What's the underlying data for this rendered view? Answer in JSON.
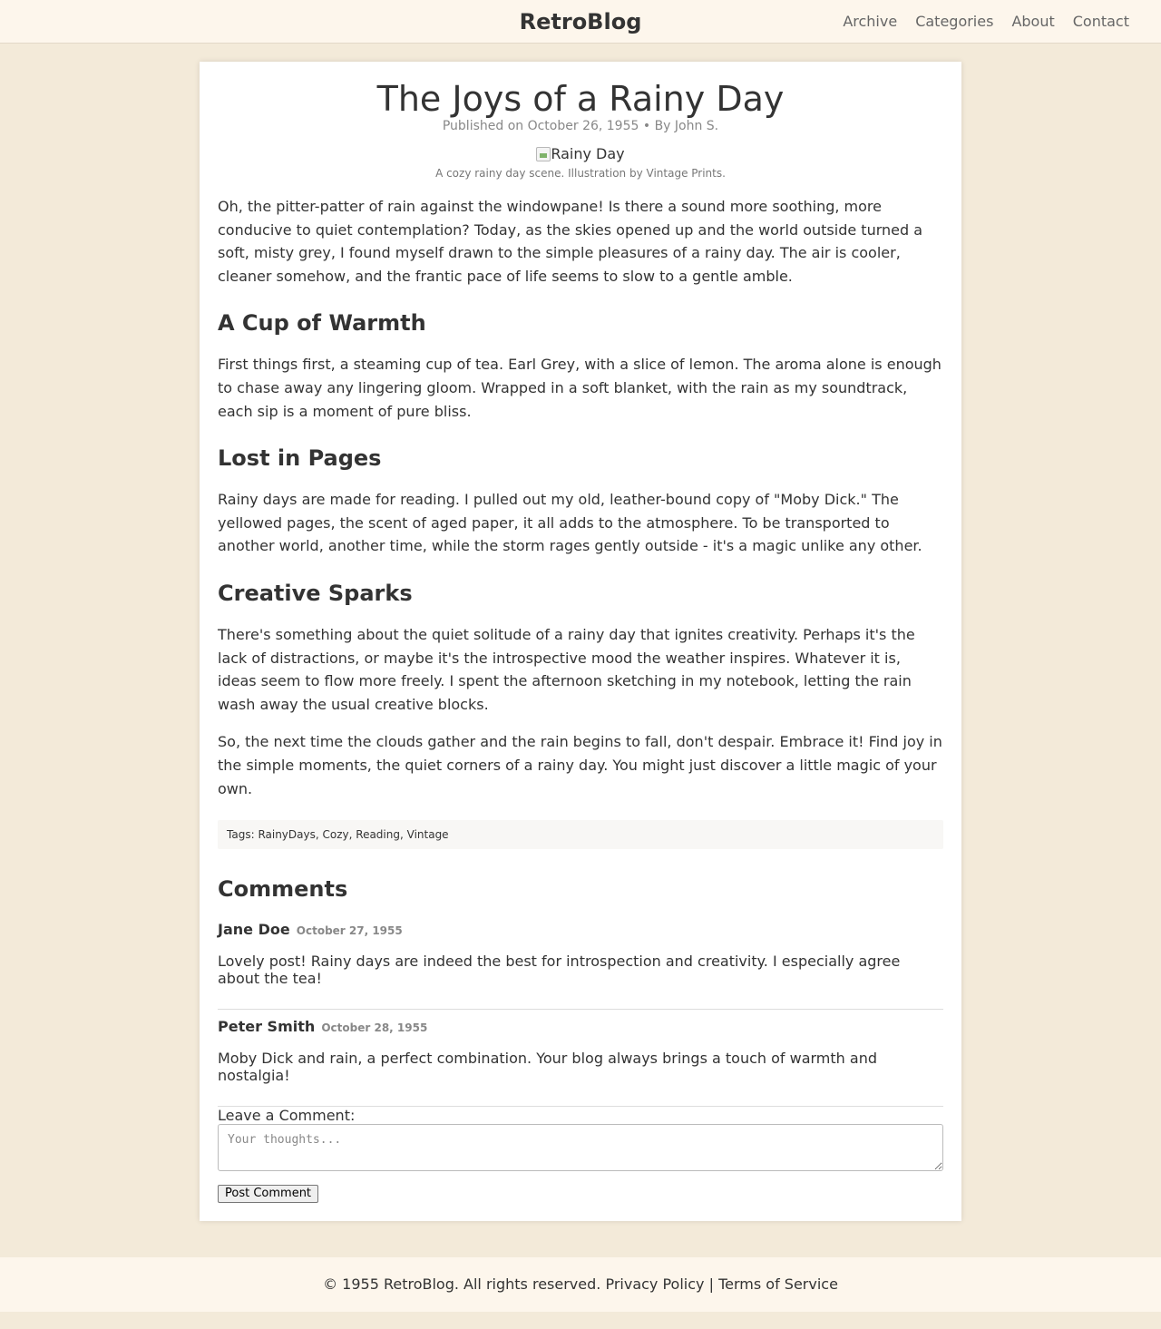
{
  "site": {
    "title": "RetroBlog",
    "nav": [
      "Archive",
      "Categories",
      "About",
      "Contact"
    ]
  },
  "post": {
    "title": "The Joys of a Rainy Day",
    "meta": "Published on October 26, 1955 • By John S.",
    "image_alt": "Rainy Day",
    "caption": "A cozy rainy day scene. Illustration by Vintage Prints.",
    "intro": "Oh, the pitter-patter of rain against the windowpane! Is there a sound more soothing, more conducive to quiet contemplation? Today, as the skies opened up and the world outside turned a soft, misty grey, I found myself drawn to the simple pleasures of a rainy day. The air is cooler, cleaner somehow, and the frantic pace of life seems to slow to a gentle amble.",
    "sections": [
      {
        "heading": "A Cup of Warmth",
        "text": "First things first, a steaming cup of tea. Earl Grey, with a slice of lemon. The aroma alone is enough to chase away any lingering gloom. Wrapped in a soft blanket, with the rain as my soundtrack, each sip is a moment of pure bliss."
      },
      {
        "heading": "Lost in Pages",
        "text": "Rainy days are made for reading. I pulled out my old, leather-bound copy of \"Moby Dick.\" The yellowed pages, the scent of aged paper, it all adds to the atmosphere. To be transported to another world, another time, while the storm rages gently outside - it's a magic unlike any other."
      },
      {
        "heading": "Creative Sparks",
        "text": "There's something about the quiet solitude of a rainy day that ignites creativity. Perhaps it's the lack of distractions, or maybe it's the introspective mood the weather inspires. Whatever it is, ideas seem to flow more freely. I spent the afternoon sketching in my notebook, letting the rain wash away the usual creative blocks."
      }
    ],
    "closing": "So, the next time the clouds gather and the rain begins to fall, don't despair. Embrace it! Find joy in the simple moments, the quiet corners of a rainy day. You might just discover a little magic of your own.",
    "tags_label": "Tags:",
    "tags": [
      "RainyDays",
      "Cozy",
      "Reading",
      "Vintage"
    ]
  },
  "comments": {
    "title": "Comments",
    "items": [
      {
        "author": "Jane Doe",
        "date": "October 27, 1955",
        "text": "Lovely post! Rainy days are indeed the best for introspection and creativity. I especially agree about the tea!"
      },
      {
        "author": "Peter Smith",
        "date": "October 28, 1955",
        "text": "Moby Dick and rain, a perfect combination. Your blog always brings a touch of warmth and nostalgia!"
      }
    ],
    "form": {
      "label": "Leave a Comment:",
      "placeholder": "Your thoughts...",
      "value": "",
      "button": "Post Comment"
    }
  },
  "footer": {
    "copyright": "© 1955 RetroBlog. All rights reserved.",
    "privacy": "Privacy Policy",
    "separator": "|",
    "terms": "Terms of Service"
  },
  "colors": {
    "page_background": "#f3ead9",
    "header_background": "#fdf6ec",
    "card_background": "#ffffff",
    "text": "#333333",
    "muted_text": "#888888"
  },
  "icons": {
    "image_placeholder": "broken-image-icon"
  }
}
